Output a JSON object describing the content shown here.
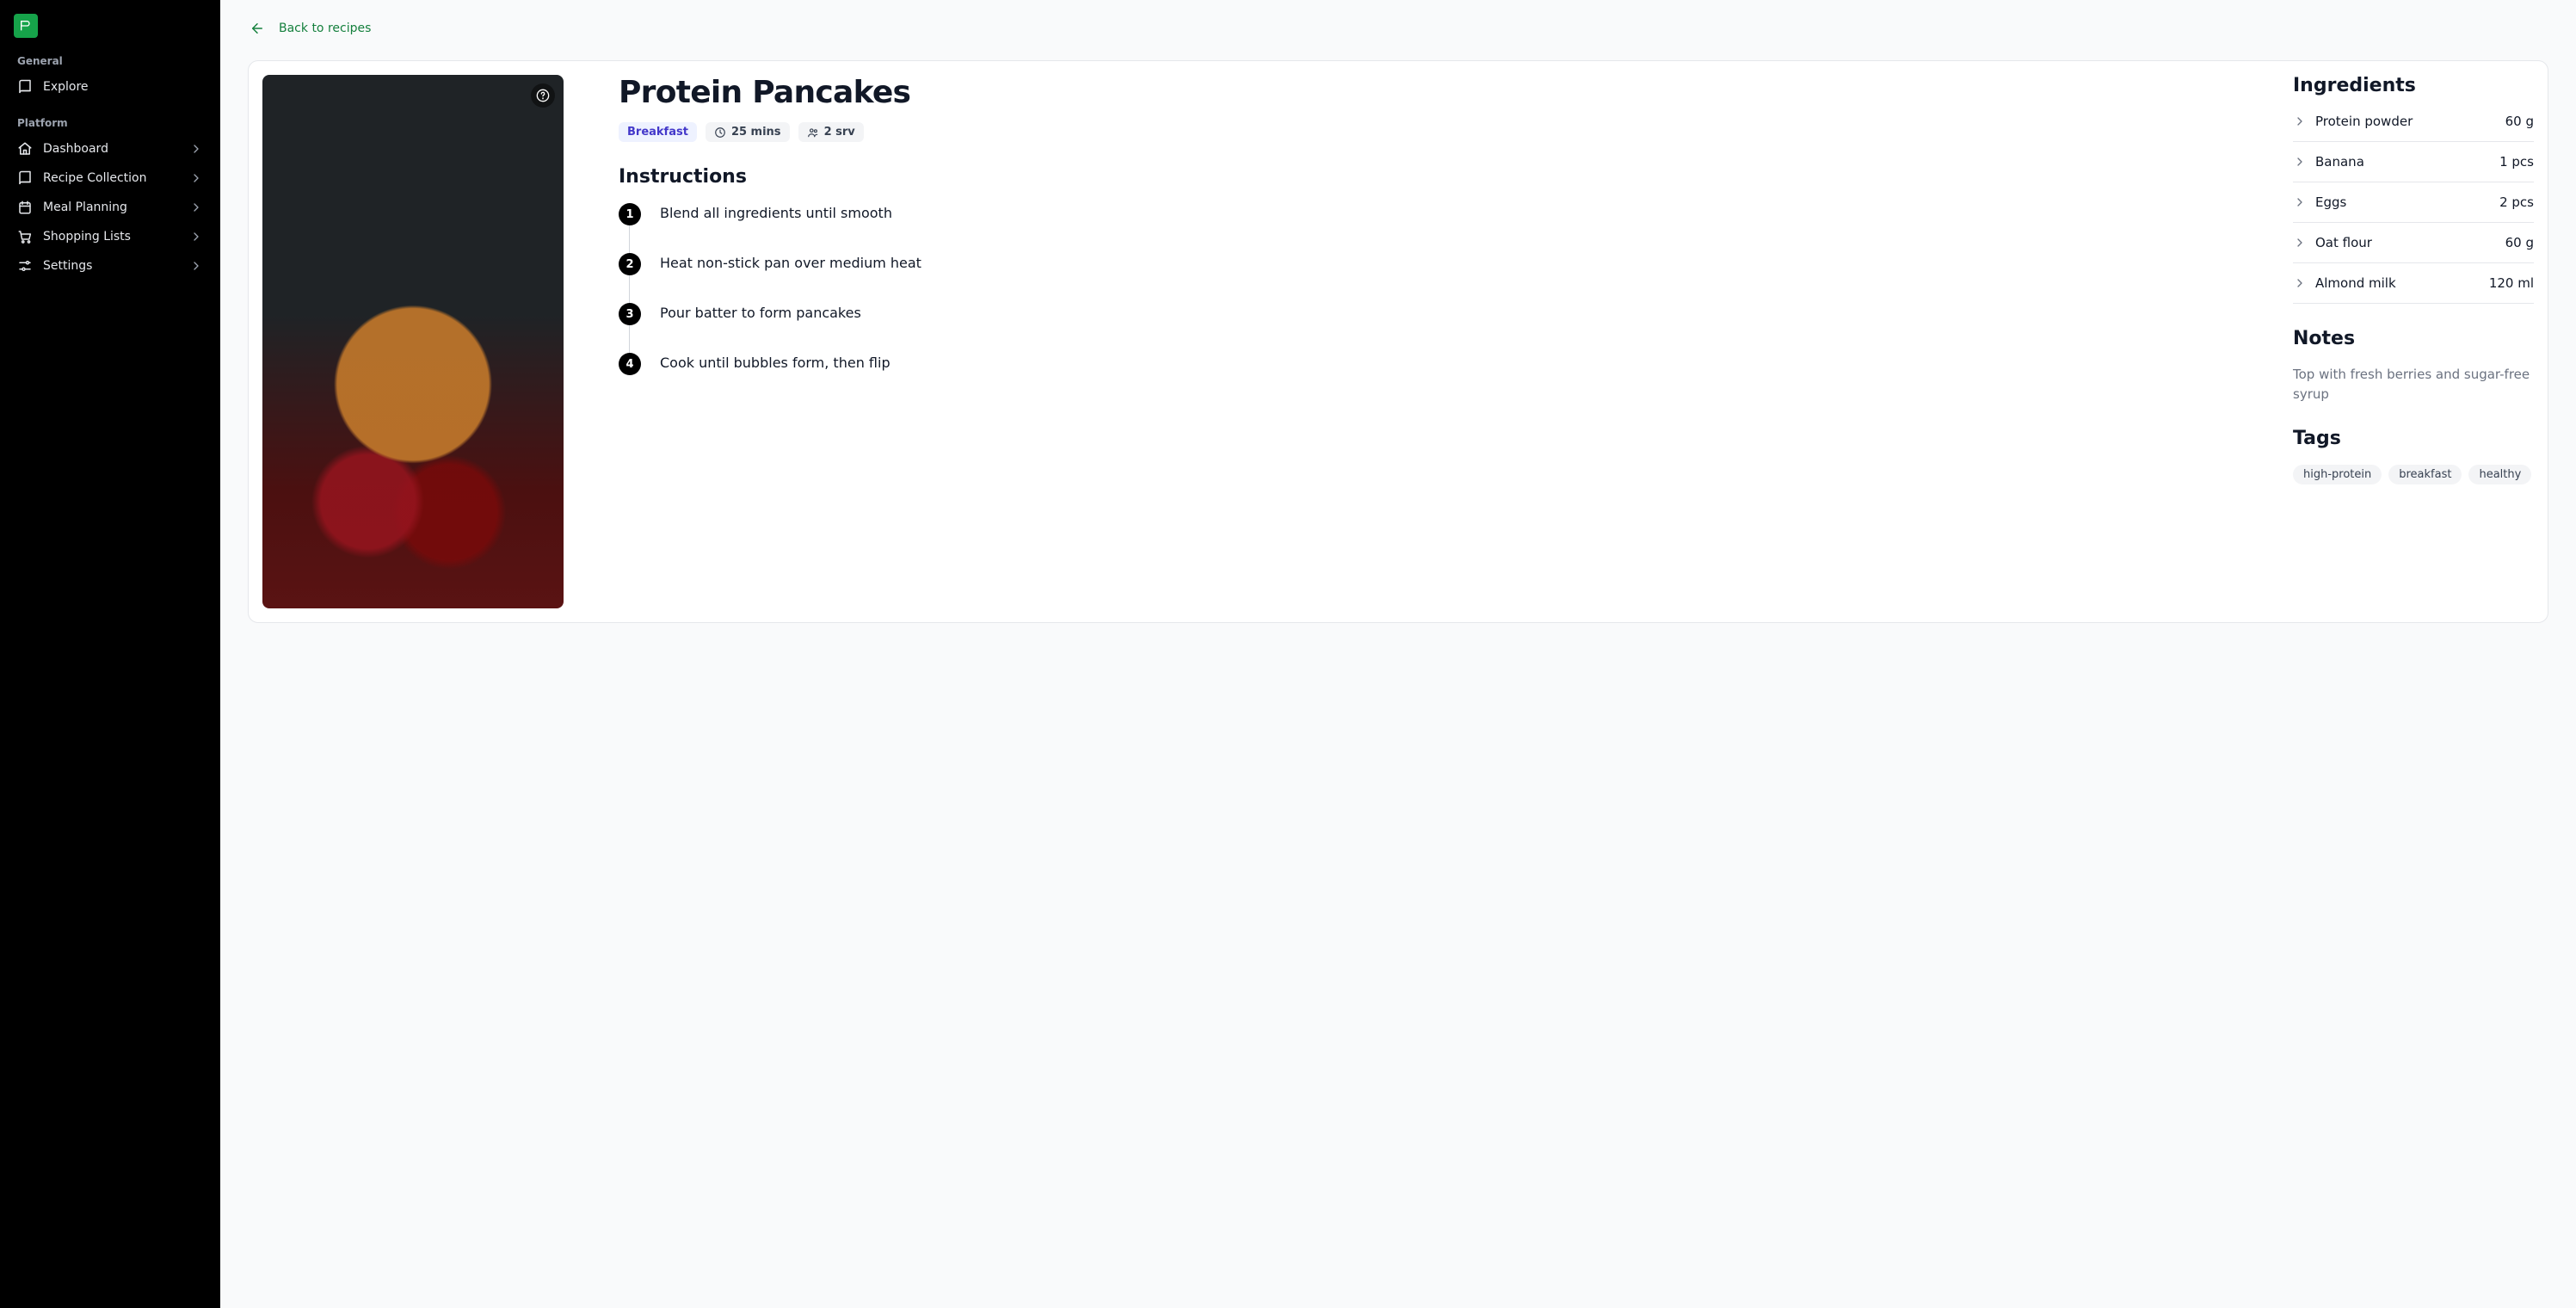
{
  "sidebar": {
    "sections": [
      {
        "label": "General",
        "items": [
          {
            "label": "Explore",
            "icon": "book",
            "hasSub": false
          }
        ]
      },
      {
        "label": "Platform",
        "items": [
          {
            "label": "Dashboard",
            "icon": "home",
            "hasSub": true
          },
          {
            "label": "Recipe Collection",
            "icon": "book",
            "hasSub": true
          },
          {
            "label": "Meal Planning",
            "icon": "calendar",
            "hasSub": true
          },
          {
            "label": "Shopping Lists",
            "icon": "cart",
            "hasSub": true
          },
          {
            "label": "Settings",
            "icon": "sliders",
            "hasSub": true
          }
        ]
      }
    ]
  },
  "backLink": "Back to recipes",
  "recipe": {
    "title": "Protein Pancakes",
    "category": "Breakfast",
    "time": "25 mins",
    "servings": "2 srv",
    "instructionsHeading": "Instructions",
    "instructions": [
      "Blend all ingredients until smooth",
      "Heat non-stick pan over medium heat",
      "Pour batter to form pancakes",
      "Cook until bubbles form, then flip"
    ],
    "ingredientsHeading": "Ingredients",
    "ingredients": [
      {
        "name": "Protein powder",
        "amount": "60 g"
      },
      {
        "name": "Banana",
        "amount": "1 pcs"
      },
      {
        "name": "Eggs",
        "amount": "2 pcs"
      },
      {
        "name": "Oat flour",
        "amount": "60 g"
      },
      {
        "name": "Almond milk",
        "amount": "120 ml"
      }
    ],
    "notesHeading": "Notes",
    "notes": "Top with fresh berries and sugar-free syrup",
    "tagsHeading": "Tags",
    "tags": [
      "high-protein",
      "breakfast",
      "healthy"
    ]
  }
}
